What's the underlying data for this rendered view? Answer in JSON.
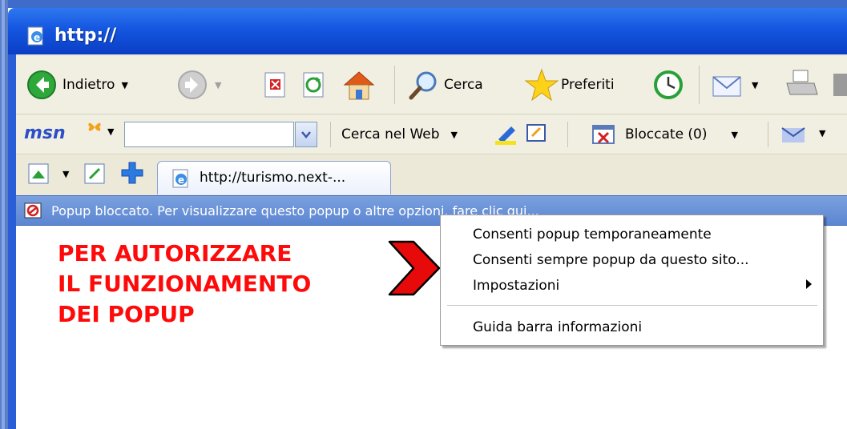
{
  "window": {
    "title": "http://",
    "colors": {
      "titlebar": "#1456e0",
      "infobar": "#6a92d8",
      "annotation": "#ff0a0a"
    }
  },
  "toolbar": {
    "back_label": "Indietro",
    "search_label": "Cerca",
    "favorites_label": "Preferiti",
    "icons": [
      "back-icon",
      "forward-icon",
      "stop-icon",
      "refresh-icon",
      "home-icon",
      "search-icon",
      "favorites-icon",
      "history-icon",
      "mail-icon",
      "print-icon"
    ]
  },
  "msnbar": {
    "logo": "msn",
    "search_input_value": "",
    "web_search_label": "Cerca nel Web",
    "blocked_label": "Bloccate (0)"
  },
  "tabs": [
    {
      "label": "http://turismo.next-..."
    }
  ],
  "infobar": {
    "text": "Popup bloccato. Per visualizzare questo popup o altre opzioni, fare clic qui..."
  },
  "annotation": {
    "lines": [
      "PER AUTORIZZARE",
      "IL FUNZIONAMENTO",
      "DEI POPUP"
    ]
  },
  "context_menu": {
    "items": [
      {
        "label": "Consenti popup temporaneamente"
      },
      {
        "label": "Consenti sempre popup da questo sito..."
      },
      {
        "label": "Impostazioni",
        "has_submenu": true
      },
      {
        "label": "Guida barra informazioni"
      }
    ]
  }
}
